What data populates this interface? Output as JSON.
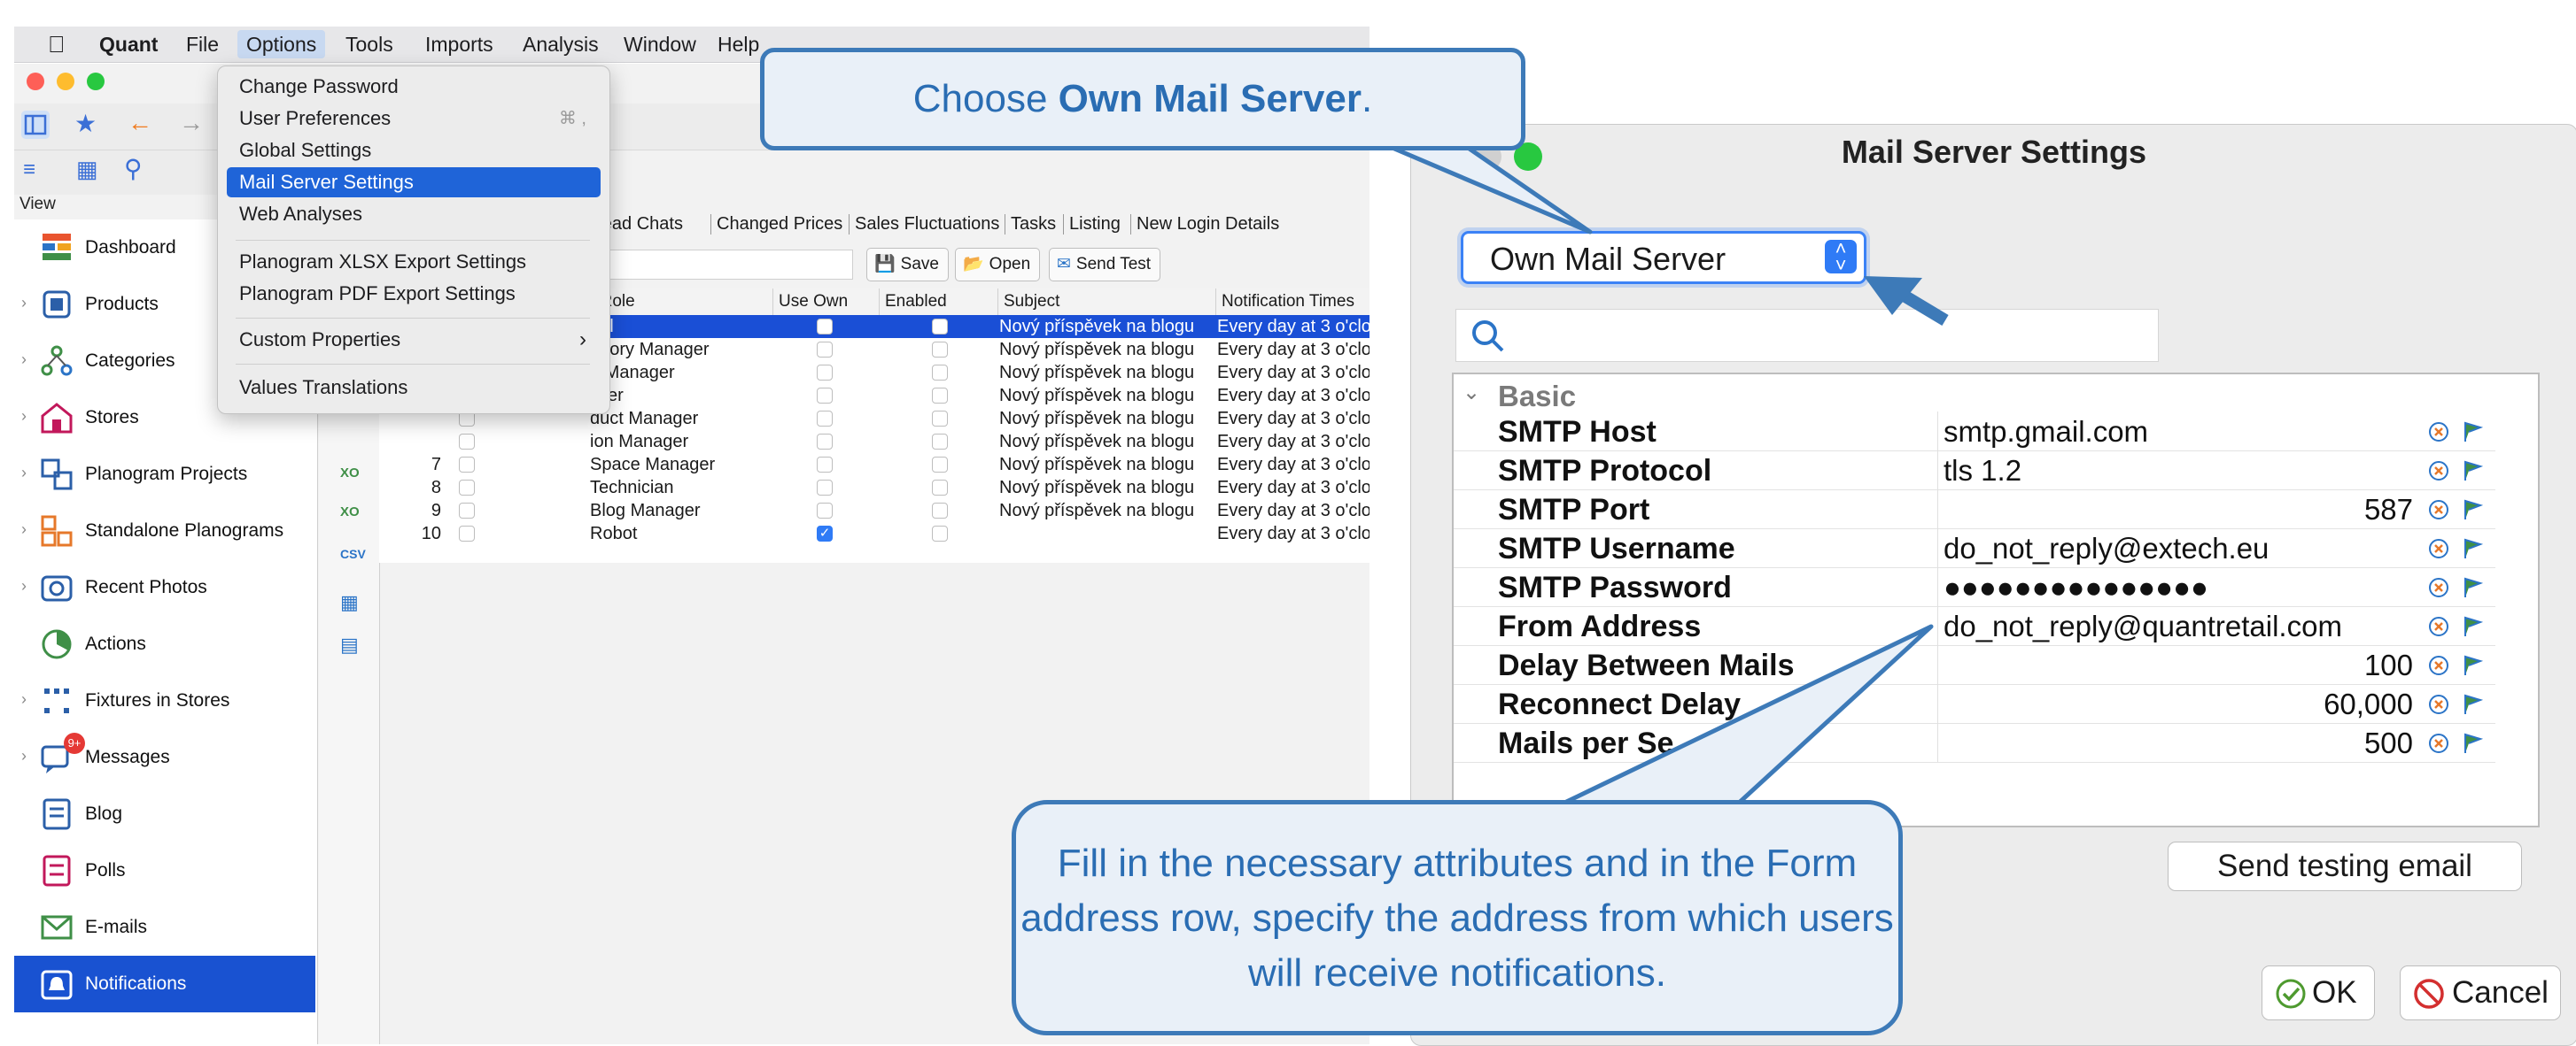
{
  "menubar": {
    "app_name": "Quant",
    "items": [
      "File",
      "Options",
      "Tools",
      "Imports",
      "Analysis",
      "Window",
      "Help"
    ]
  },
  "options_menu": {
    "items": [
      {
        "label": "Change Password",
        "shortcut": ""
      },
      {
        "label": "User Preferences",
        "shortcut": "⌘ ,"
      },
      {
        "label": "Global Settings",
        "shortcut": ""
      },
      {
        "label": "Mail Server Settings",
        "shortcut": "",
        "highlighted": true
      },
      {
        "label": "Web Analyses",
        "shortcut": ""
      },
      {
        "label": "Planogram XLSX Export Settings",
        "shortcut": ""
      },
      {
        "label": "Planogram PDF Export Settings",
        "shortcut": ""
      },
      {
        "label": "Custom Properties",
        "shortcut": "",
        "submenu": true
      },
      {
        "label": "Values Translations",
        "shortcut": ""
      }
    ]
  },
  "sidebar": {
    "view_label": "View",
    "items": [
      {
        "label": "Dashboard",
        "icon": "dashboard-icon",
        "expandable": false
      },
      {
        "label": "Products",
        "icon": "products-icon",
        "expandable": true
      },
      {
        "label": "Categories",
        "icon": "categories-icon",
        "expandable": true
      },
      {
        "label": "Stores",
        "icon": "stores-icon",
        "expandable": true
      },
      {
        "label": "Planogram Projects",
        "icon": "planogram-projects-icon",
        "expandable": true
      },
      {
        "label": "Standalone Planograms",
        "icon": "standalone-planograms-icon",
        "expandable": true
      },
      {
        "label": "Recent Photos",
        "icon": "camera-icon",
        "expandable": true
      },
      {
        "label": "Actions",
        "icon": "actions-icon",
        "expandable": false
      },
      {
        "label": "Fixtures in Stores",
        "icon": "fixtures-icon",
        "expandable": true
      },
      {
        "label": "Messages",
        "icon": "messages-icon",
        "expandable": true,
        "badge": "9+"
      },
      {
        "label": "Blog",
        "icon": "blog-icon",
        "expandable": false
      },
      {
        "label": "Polls",
        "icon": "polls-icon",
        "expandable": false
      },
      {
        "label": "E-mails",
        "icon": "email-icon",
        "expandable": false
      },
      {
        "label": "Notifications",
        "icon": "notifications-icon",
        "expandable": false,
        "active": true
      }
    ]
  },
  "tabs": [
    "nread Chats",
    "Changed Prices",
    "Sales Fluctuations",
    "Tasks",
    "Listing",
    "New Login Details"
  ],
  "actions": {
    "save": "Save",
    "open": "Open",
    "send_test": "Send Test"
  },
  "table": {
    "columns": [
      "r Role",
      "Use Own",
      "Enabled",
      "Subject",
      "Notification Times"
    ],
    "rows": [
      {
        "num": "",
        "role": "bal",
        "use_own": false,
        "enabled": false,
        "subject": "Nový příspěvek na blogu",
        "times": "Every day at 3 o'clo",
        "selected": true
      },
      {
        "num": "",
        "role": "egory Manager",
        "use_own": false,
        "enabled": false,
        "subject": "Nový příspěvek na blogu",
        "times": "Every day at 3 o'clo"
      },
      {
        "num": "",
        "role": "e Manager",
        "use_own": false,
        "enabled": false,
        "subject": "Nový příspěvek na blogu",
        "times": "Every day at 3 o'clo"
      },
      {
        "num": "",
        "role": "plier",
        "use_own": false,
        "enabled": false,
        "subject": "Nový příspěvek na blogu",
        "times": "Every day at 3 o'clo"
      },
      {
        "num": "",
        "role": "duct Manager",
        "use_own": false,
        "enabled": false,
        "subject": "Nový příspěvek na blogu",
        "times": "Every day at 3 o'clo"
      },
      {
        "num": "",
        "role": "ion Manager",
        "use_own": false,
        "enabled": false,
        "subject": "Nový příspěvek na blogu",
        "times": "Every day at 3 o'clo"
      },
      {
        "num": "7",
        "role": "Space Manager",
        "use_own": false,
        "enabled": false,
        "subject": "Nový příspěvek na blogu",
        "times": "Every day at 3 o'clo"
      },
      {
        "num": "8",
        "role": "Technician",
        "use_own": false,
        "enabled": false,
        "subject": "Nový příspěvek na blogu",
        "times": "Every day at 3 o'clo"
      },
      {
        "num": "9",
        "role": "Blog Manager",
        "use_own": false,
        "enabled": false,
        "subject": "Nový příspěvek na blogu",
        "times": "Every day at 3 o'clo"
      },
      {
        "num": "10",
        "role": "Robot",
        "use_own": true,
        "enabled": false,
        "subject": "",
        "times": "Every day at 3 o'clo"
      }
    ]
  },
  "dialog": {
    "title": "Mail Server Settings",
    "server_type": "Own Mail Server",
    "group": "Basic",
    "properties": [
      {
        "key": "SMTP Host",
        "value": "smtp.gmail.com",
        "align": "left"
      },
      {
        "key": "SMTP Protocol",
        "value": "tls 1.2",
        "align": "left"
      },
      {
        "key": "SMTP Port",
        "value": "587",
        "align": "right"
      },
      {
        "key": "SMTP Username",
        "value": "do_not_reply@extech.eu",
        "align": "left"
      },
      {
        "key": "SMTP Password",
        "value": "●●●●●●●●●●●●●●●",
        "align": "left"
      },
      {
        "key": "From Address",
        "value": "do_not_reply@quantretail.com",
        "align": "left"
      },
      {
        "key": "Delay Between Mails",
        "value": "100",
        "align": "right"
      },
      {
        "key": "Reconnect Delay",
        "value": "60,000",
        "align": "right"
      },
      {
        "key": "Mails per Se",
        "value": "500",
        "align": "right"
      }
    ],
    "send_test_label": "Send testing email",
    "ok_label": "OK",
    "cancel_label": "Cancel"
  },
  "callouts": {
    "choose_prefix": "Choose ",
    "choose_bold": "Own Mail Server",
    "choose_suffix": ".",
    "fill_in": "Fill in the necessary attributes and in the Form address row, specify the address from which users will receive notifications."
  },
  "colors": {
    "accent": "#1f64d8",
    "sidebar_active": "#1952d1",
    "callout_border": "#3d7ab8",
    "callout_text": "#2a6db3",
    "callout_fill": "#e9f0f8"
  }
}
